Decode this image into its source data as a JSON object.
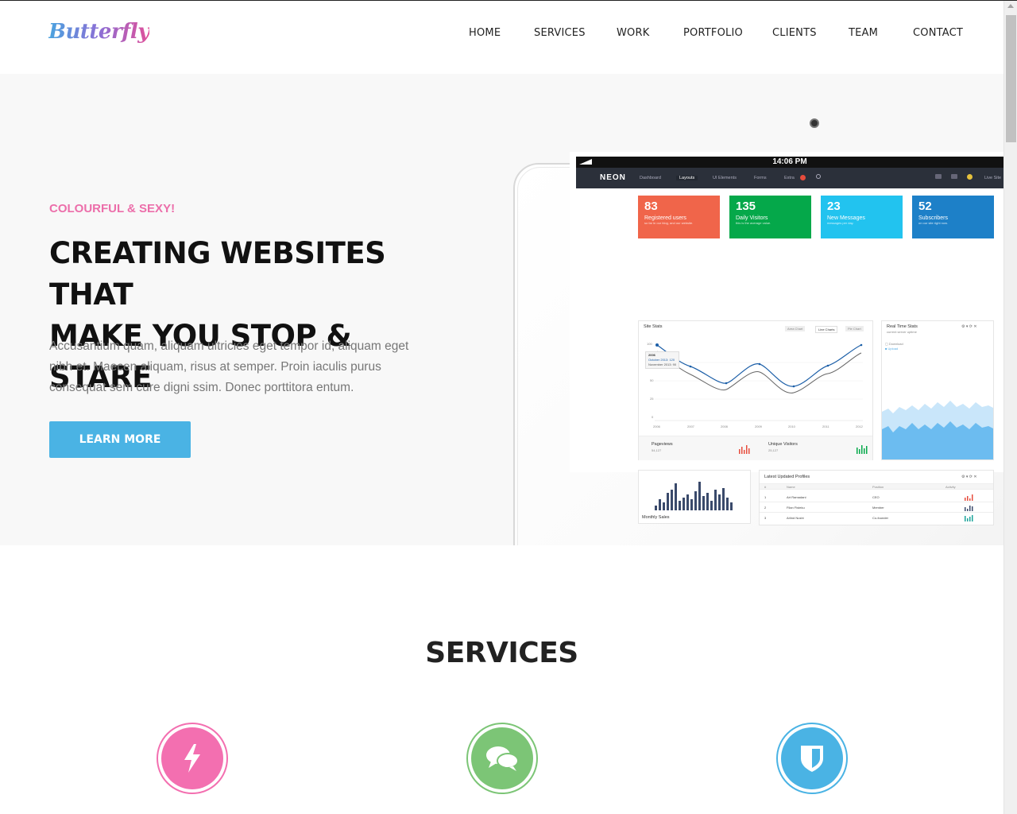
{
  "header": {
    "logo": "Butterfly",
    "nav": [
      "HOME",
      "SERVICES",
      "WORK",
      "PORTFOLIO",
      "CLIENTS",
      "TEAM",
      "CONTACT"
    ]
  },
  "hero": {
    "kicker": "COLOURFUL & SEXY!",
    "headline_line1": "CREATING WEBSITES THAT",
    "headline_line2": "MAKE YOU STOP & STARE",
    "lede": "Accusantium quam, aliquam ultricies eget tempor id, aliquam eget nibh et. Maecen aliquam, risus at semper. Proin iaculis purus consequat sem cure digni ssim. Donec porttitora entum.",
    "cta_label": "LEARN MORE"
  },
  "mockup": {
    "clock": "14:06 PM",
    "app_name": "NEON",
    "menu": [
      "Dashboard",
      "Layouts",
      "UI Elements",
      "Forms",
      "Extra"
    ],
    "live_site": "Live Site",
    "tiles": [
      {
        "num": "83",
        "label": "Registered users",
        "sub": "so far in our blog, and our website.",
        "color": "#f0654a"
      },
      {
        "num": "135",
        "label": "Daily Visitors",
        "sub": "this is the average value.",
        "color": "#05a84a"
      },
      {
        "num": "23",
        "label": "New Messages",
        "sub": "messages per day.",
        "color": "#22c3ef"
      },
      {
        "num": "52",
        "label": "Subscribers",
        "sub": "on our site right now.",
        "color": "#1d80c8"
      }
    ],
    "site_stats_title": "Site Stats",
    "chart_tabs": [
      "Area Chart",
      "Line Charts",
      "Pie Chart"
    ],
    "yticks": [
      "100",
      "75",
      "50",
      "25",
      "0"
    ],
    "xticks": [
      "2006",
      "2007",
      "2008",
      "2009",
      "2010",
      "2011",
      "2012"
    ],
    "tooltip": [
      "2006",
      "October 2013: 120",
      "November 2013: 90"
    ],
    "pageviews": "Pageviews",
    "pageviews_val": "54,127",
    "unique_visitors": "Unique Visitors",
    "unique_val": "25,127",
    "realtime_title": "Real Time Stats",
    "realtime_sub": "current server uptime",
    "legend": [
      "Download",
      "Upload"
    ],
    "monthly_sales": "Monthly Sales",
    "profiles_title": "Latest Updated Profiles",
    "profiles_headers": [
      "#",
      "Name",
      "Position",
      "Activity"
    ],
    "profiles_rows": [
      [
        "1",
        "Art Ramadani",
        "CEO"
      ],
      [
        "2",
        "Filan Fisteku",
        "Member"
      ],
      [
        "3",
        "Arlind Nushi",
        "Co-founder"
      ]
    ]
  },
  "services": {
    "title": "SERVICES",
    "icons": [
      {
        "name": "lightning-icon",
        "color": "#f36fb0"
      },
      {
        "name": "chat-bubbles-icon",
        "color": "#7cc576"
      },
      {
        "name": "shield-icon",
        "color": "#4ab3e4"
      }
    ]
  }
}
